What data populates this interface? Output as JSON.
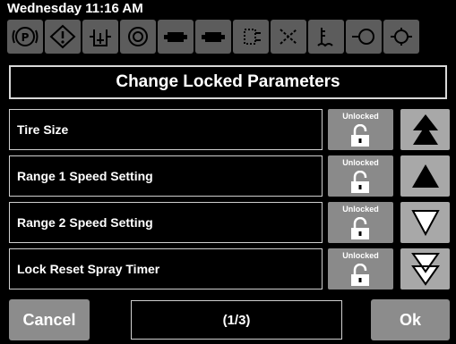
{
  "status": {
    "time": "Wednesday 11:16 AM"
  },
  "warning_icons": [
    "parking-brake-icon",
    "warning-icon",
    "coolant-level-icon",
    "brake-fault-icon",
    "battery-icon",
    "battery-alt-icon",
    "filter-icon",
    "fuel-filter-icon",
    "coolant-temp-icon",
    "oil-level-icon",
    "oil-pressure-icon"
  ],
  "header": {
    "title": "Change Locked Parameters"
  },
  "parameters": [
    {
      "label": "Tire Size",
      "lock_status": "Unlocked"
    },
    {
      "label": "Range 1 Speed Setting",
      "lock_status": "Unlocked"
    },
    {
      "label": "Range 2 Speed Setting",
      "lock_status": "Unlocked"
    },
    {
      "label": "Lock Reset Spray Timer",
      "lock_status": "Unlocked"
    }
  ],
  "nav": [
    "page-up-icon",
    "scroll-up-icon",
    "scroll-down-icon",
    "page-down-icon"
  ],
  "footer": {
    "cancel_label": "Cancel",
    "page_indicator": "(1/3)",
    "ok_label": "Ok"
  },
  "colors": {
    "background": "#000000",
    "button_gray": "#8a8a8a",
    "arrow_button": "#a8a8a8",
    "icon_gray": "#5c5c5c"
  }
}
